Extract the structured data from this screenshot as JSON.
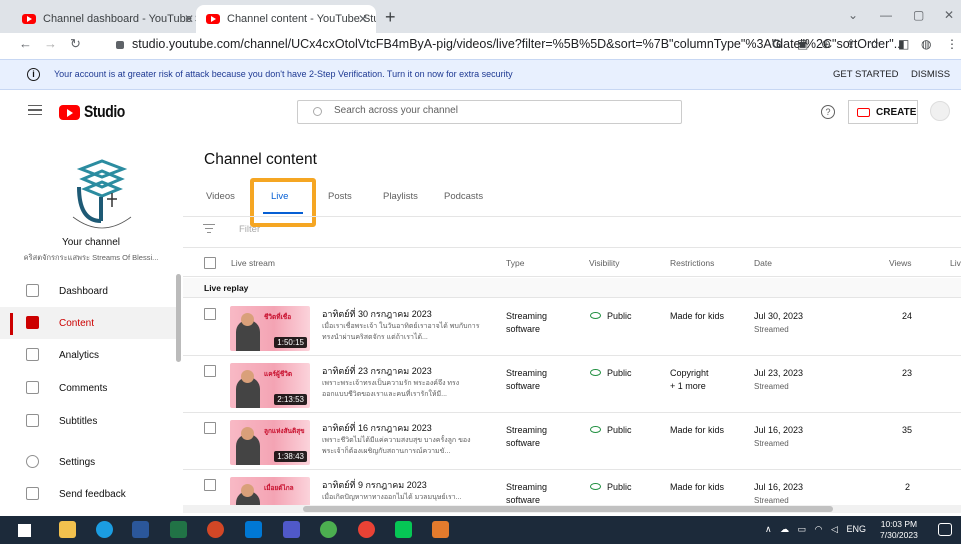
{
  "browser": {
    "tabs": [
      {
        "label": "Channel dashboard - YouTube St"
      },
      {
        "label": "Channel content - YouTube Studi"
      }
    ],
    "new_tab": "+",
    "url": "studio.youtube.com/channel/UCx4cxOtolVtcFB4mByA-pig/videos/live?filter=%5B%5D&sort=%7B\"columnType\"%3A\"date\"%2C\"sortOrder\"..."
  },
  "warning": {
    "message": "Your account is at greater risk of attack because you don't have 2-Step Verification. Turn it on now for extra security",
    "get_started": "GET STARTED",
    "dismiss": "DISMISS"
  },
  "header": {
    "logo_text": "Studio",
    "search_placeholder": "Search across your channel",
    "help": "?",
    "create_label": "CREATE"
  },
  "sidebar": {
    "channel_label": "Your channel",
    "channel_name": "คริสตจักรกระแสพระ Streams Of Blessi...",
    "items": [
      {
        "label": "Dashboard",
        "icon": "dashboard-icon"
      },
      {
        "label": "Content",
        "icon": "content-icon",
        "active": true
      },
      {
        "label": "Analytics",
        "icon": "analytics-icon"
      },
      {
        "label": "Comments",
        "icon": "comments-icon"
      },
      {
        "label": "Subtitles",
        "icon": "subtitles-icon"
      },
      {
        "label": "Settings",
        "icon": "settings-icon"
      },
      {
        "label": "Send feedback",
        "icon": "feedback-icon"
      }
    ]
  },
  "main": {
    "title": "Channel content",
    "tabs": [
      "Videos",
      "Live",
      "Posts",
      "Playlists",
      "Podcasts"
    ],
    "active_tab": "Live",
    "filter_label": "Filter",
    "columns": [
      "Live stream",
      "Type",
      "Visibility",
      "Restrictions",
      "Date",
      "Views",
      "Liv"
    ],
    "section_label": "Live replay",
    "rows": [
      {
        "thumb_title": "ชีวิตที่เชื่อ",
        "duration": "1:50:15",
        "title": "อาทิตย์ที่ 30 กรกฎาคม 2023",
        "desc": "เมื่อเราเชื่อพระเจ้า ในวันอาทิตย์เราอาจได้ พบกับการทรงนำผ่านคริสตจักร แต่ถ้าเราได้...",
        "type": "Streaming software",
        "visibility": "Public",
        "restriction": "Made for kids",
        "restriction2": "",
        "date": "Jul 30, 2023",
        "date_sub": "Streamed",
        "views": "24"
      },
      {
        "thumb_title": "แคร์ผู้ชีวิต",
        "duration": "2:13:53",
        "title": "อาทิตย์ที่ 23 กรกฎาคม 2023",
        "desc": "เพราะพระเจ้าทรงเป็นความรัก พระองค์จึง ทรงออกแบบชีวิตของเราและคนที่เรารักให้มี...",
        "type": "Streaming software",
        "visibility": "Public",
        "restriction": "Copyright",
        "restriction2": "+ 1 more",
        "date": "Jul 23, 2023",
        "date_sub": "Streamed",
        "views": "23"
      },
      {
        "thumb_title": "ลูกแห่งสันติสุข",
        "duration": "1:38:43",
        "title": "อาทิตย์ที่ 16 กรกฎาคม 2023",
        "desc": "เพราะชีวิตไม่ได้มีแค่ความสงบสุข บางครั้งลูก ของพระเจ้าก็ต้องเผชิญกับสถานการณ์ความขั...",
        "type": "Streaming software",
        "visibility": "Public",
        "restriction": "Made for kids",
        "restriction2": "",
        "date": "Jul 16, 2023",
        "date_sub": "Streamed",
        "views": "35"
      },
      {
        "thumb_title": "เมื่อยต์ไกล",
        "duration": "",
        "title": "อาทิตย์ที่ 9 กรกฎาคม 2023",
        "desc": "เมื่อเกิดปัญหาหาทางออกไม่ได้ มวลมนุษย์เรา...",
        "type": "Streaming software",
        "visibility": "Public",
        "restriction": "Made for kids",
        "restriction2": "",
        "date": "Jul 16, 2023",
        "date_sub": "Streamed",
        "views": "2"
      }
    ]
  },
  "taskbar": {
    "lang": "ENG",
    "time": "10:03 PM",
    "date": "7/30/2023"
  },
  "colors": {
    "accent": "#065fd4",
    "youtube_red": "#ff0000",
    "highlight": "#f5a623",
    "taskbar": "#1c2a3a"
  }
}
